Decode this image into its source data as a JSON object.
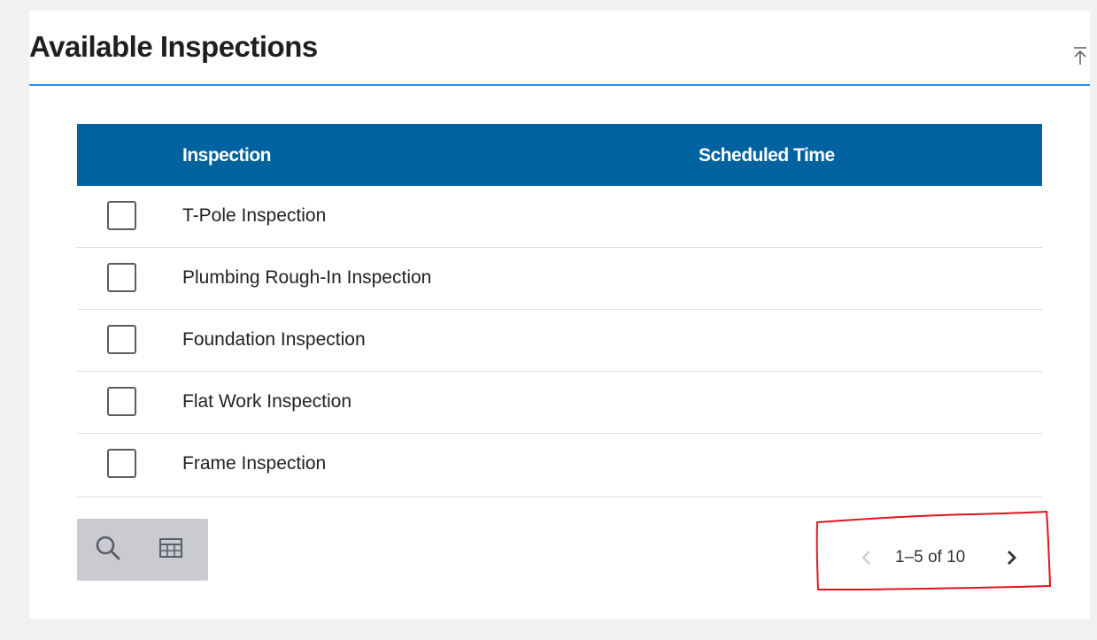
{
  "panel": {
    "title": "Available Inspections"
  },
  "table": {
    "columns": [
      "Inspection",
      "Scheduled Time"
    ],
    "rows": [
      {
        "name": "T-Pole Inspection",
        "checked": false
      },
      {
        "name": "Plumbing Rough-In Inspection",
        "checked": false
      },
      {
        "name": "Foundation Inspection",
        "checked": false
      },
      {
        "name": "Flat Work Inspection",
        "checked": false
      },
      {
        "name": "Frame Inspection",
        "checked": false
      }
    ]
  },
  "toolbar": {
    "search_icon": "search-icon",
    "columns_icon": "view-column-icon"
  },
  "pagination": {
    "range_text": "1–5 of 10",
    "prev_icon": "chevron-left-icon",
    "next_icon": "chevron-right-icon",
    "prev_enabled": false,
    "next_enabled": true
  },
  "colors": {
    "header_bg": "#00629e",
    "header_rule": "#2b8fe0",
    "annotation": "#e0141e"
  }
}
